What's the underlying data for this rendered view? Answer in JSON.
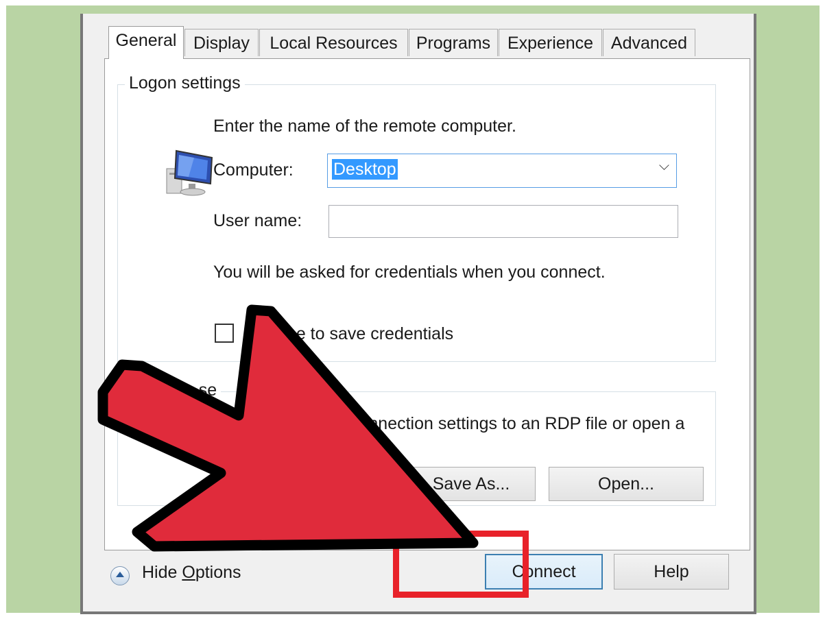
{
  "tabs": [
    "General",
    "Display",
    "Local Resources",
    "Programs",
    "Experience",
    "Advanced"
  ],
  "logon": {
    "legend": "Logon settings",
    "instruction": "Enter the name of the remote computer.",
    "computer_label": "Computer:",
    "computer_value": "Desktop",
    "username_label": "User name:",
    "username_value": "",
    "credentials_note": "You will be asked for credentials when you connect.",
    "save_credentials_label": "me to save credentials",
    "save_credentials_checked": false
  },
  "connection": {
    "legend": "ction se",
    "description": "connection settings to an RDP file or open a",
    "save_as_label": "Save As...",
    "open_label": "Open..."
  },
  "footer": {
    "hide_options_prefix": "Hide ",
    "hide_options_accel": "O",
    "hide_options_rest": "ptions",
    "connect_label": "Connect",
    "help_label": "Help"
  },
  "colors": {
    "background": "#b9d4a4",
    "arrow_fill": "#e02b3b",
    "highlight": "#e8222a",
    "selection": "#3399ff"
  },
  "icons": {
    "computer": "remote-computer-icon",
    "hide_options": "chevron-up-circle-icon",
    "dropdown": "chevron-down-icon"
  }
}
